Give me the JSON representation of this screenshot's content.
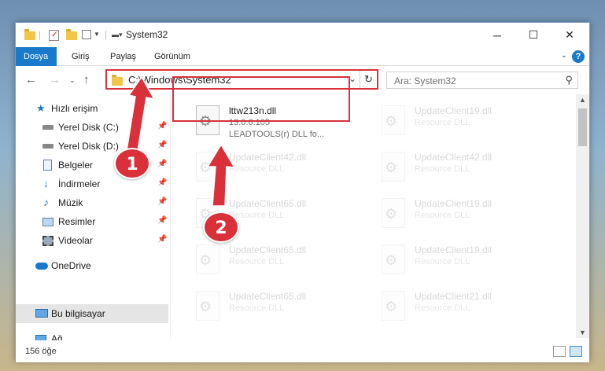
{
  "window": {
    "title": "System32",
    "controls": {
      "minimize": "─",
      "maximize": "☐",
      "close": "✕"
    }
  },
  "ribbon": {
    "tabs": [
      {
        "label": "Dosya",
        "active": true
      },
      {
        "label": "Giriş"
      },
      {
        "label": "Paylaş"
      },
      {
        "label": "Görünüm"
      }
    ],
    "help": "?"
  },
  "address": {
    "path": "C:\\Windows\\System32",
    "search_placeholder": "Ara: System32"
  },
  "nav_pane": {
    "items": [
      {
        "label": "Hızlı erişim",
        "icon": "star-icon",
        "pinned": false
      },
      {
        "label": "Yerel Disk (C:)",
        "icon": "drive-icon",
        "pinned": true
      },
      {
        "label": "Yerel Disk (D:)",
        "icon": "drive-icon",
        "pinned": true
      },
      {
        "label": "Belgeler",
        "icon": "documents-icon",
        "pinned": true
      },
      {
        "label": "İndirmeler",
        "icon": "download-icon",
        "pinned": true
      },
      {
        "label": "Müzik",
        "icon": "music-icon",
        "pinned": true
      },
      {
        "label": "Resimler",
        "icon": "pictures-icon",
        "pinned": true
      },
      {
        "label": "Videolar",
        "icon": "videos-icon",
        "pinned": true
      },
      {
        "label": "OneDrive",
        "icon": "onedrive-icon",
        "pinned": false
      },
      {
        "label": "Bu bilgisayar",
        "icon": "computer-icon",
        "pinned": false,
        "selected": true
      },
      {
        "label": "Ağ",
        "icon": "network-icon",
        "pinned": false
      }
    ]
  },
  "files": [
    {
      "name": "lttw213n.dll",
      "line1": "13.0.0.105",
      "line2": "LEADTOOLS(r) DLL fo...",
      "highlighted": true
    },
    {
      "name": "UpdateClient19.dll",
      "line1": "Resource DLL"
    },
    {
      "name": "UpdateClient42.dll",
      "line1": "Resource DLL"
    },
    {
      "name": "UpdateClient42.dll",
      "line1": "Resource DLL"
    },
    {
      "name": "UpdateClient65.dll",
      "line1": "Resource DLL"
    },
    {
      "name": "UpdateClient19.dll",
      "line1": "Resource DLL"
    },
    {
      "name": "UpdateClient65.dll",
      "line1": "Resource DLL"
    },
    {
      "name": "UpdateClient19.dll",
      "line1": "Resource DLL"
    },
    {
      "name": "UpdateClient65.dll",
      "line1": "Resource DLL"
    },
    {
      "name": "UpdateClient21.dll",
      "line1": "Resource DLL"
    }
  ],
  "status": {
    "count": "156 öğe"
  },
  "annotations": {
    "step1": "1",
    "step2": "2",
    "color": "#d9303a"
  }
}
